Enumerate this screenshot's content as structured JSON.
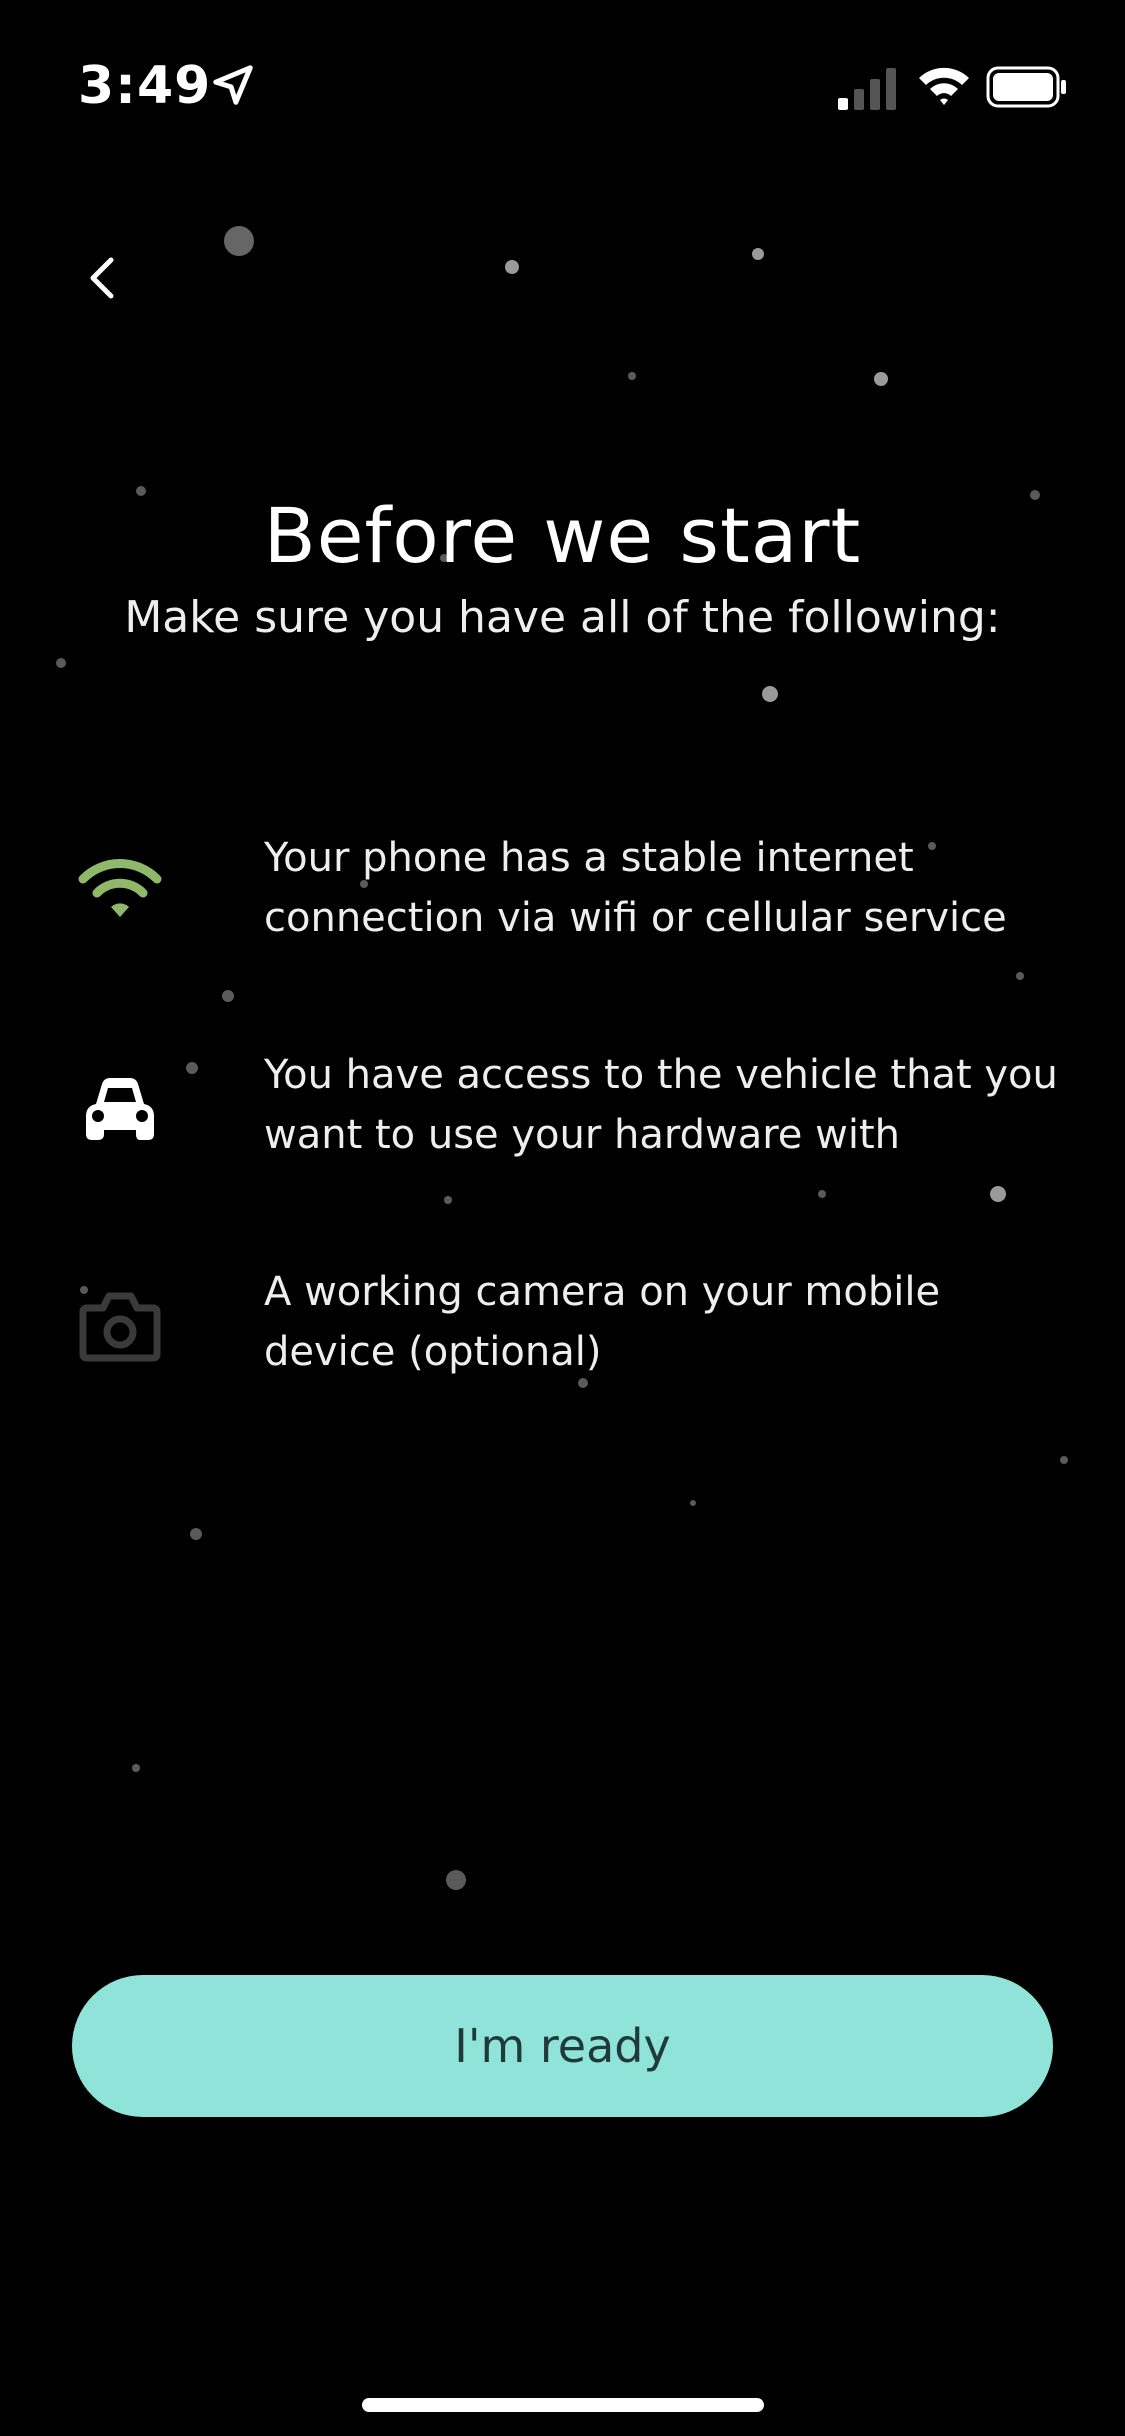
{
  "status_bar": {
    "time": "3:49"
  },
  "header": {
    "title": "Before we start",
    "subtitle": "Make sure you have all of the following:"
  },
  "requirements": [
    {
      "icon": "wifi-icon",
      "color": "#8fb86a",
      "text": "Your phone has a stable internet connection via wifi or cellular service"
    },
    {
      "icon": "car-icon",
      "color": "#ffffff",
      "text": "You have access to the vehicle that you want to use your hardware with"
    },
    {
      "icon": "camera-icon",
      "color": "#3a3a3a",
      "text": "A working camera on your mobile device (optional)"
    }
  ],
  "actions": {
    "ready_label": "I'm ready"
  },
  "colors": {
    "accent": "#8fe3d8",
    "background": "#000000"
  }
}
